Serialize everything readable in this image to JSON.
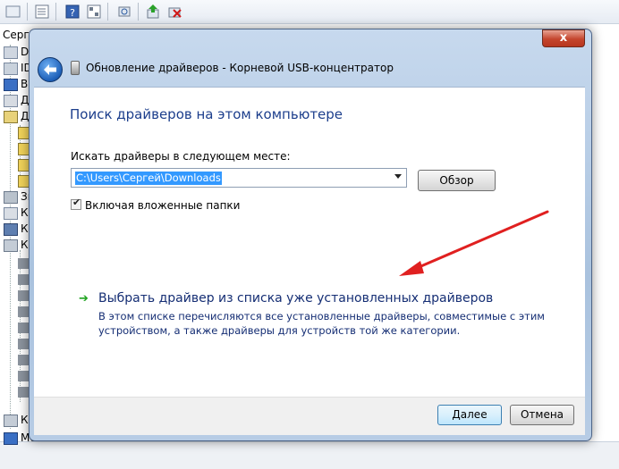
{
  "background": {
    "tree_root": "Серге",
    "tree_items": [
      "DV",
      "ID",
      "Ви",
      "Ди",
      "Др",
      "Зв",
      "Кл",
      "Ко",
      "Ко",
      "Ко",
      "Мо"
    ]
  },
  "dialog": {
    "title": "Обновление драйверов - Корневой USB-концентратор",
    "close_label": "x",
    "heading": "Поиск драйверов на этом компьютере",
    "path_label": "Искать драйверы в следующем месте:",
    "path_value": "C:\\Users\\Сергей\\Downloads",
    "browse_label": "Обзор",
    "include_subfolders_label": "Включая вложенные папки",
    "include_subfolders_checked": true,
    "pick_driver_title": "Выбрать драйвер из списка уже установленных драйверов",
    "pick_driver_desc": "В этом списке перечисляются все установленные драйверы, совместимые с этим устройством, а также драйверы для устройств той же категории.",
    "next_label": "Далее",
    "cancel_label": "Отмена"
  },
  "icons": {
    "back": "back-arrow-icon",
    "usb": "usb-device-icon",
    "check": "checkmark-icon",
    "link_arrow": "green-arrow-icon",
    "annotation": "red-arrow-annotation"
  },
  "colors": {
    "heading": "#1c3e8c",
    "link": "#152e74",
    "selection": "#3399ff",
    "annotation": "#e02020"
  }
}
